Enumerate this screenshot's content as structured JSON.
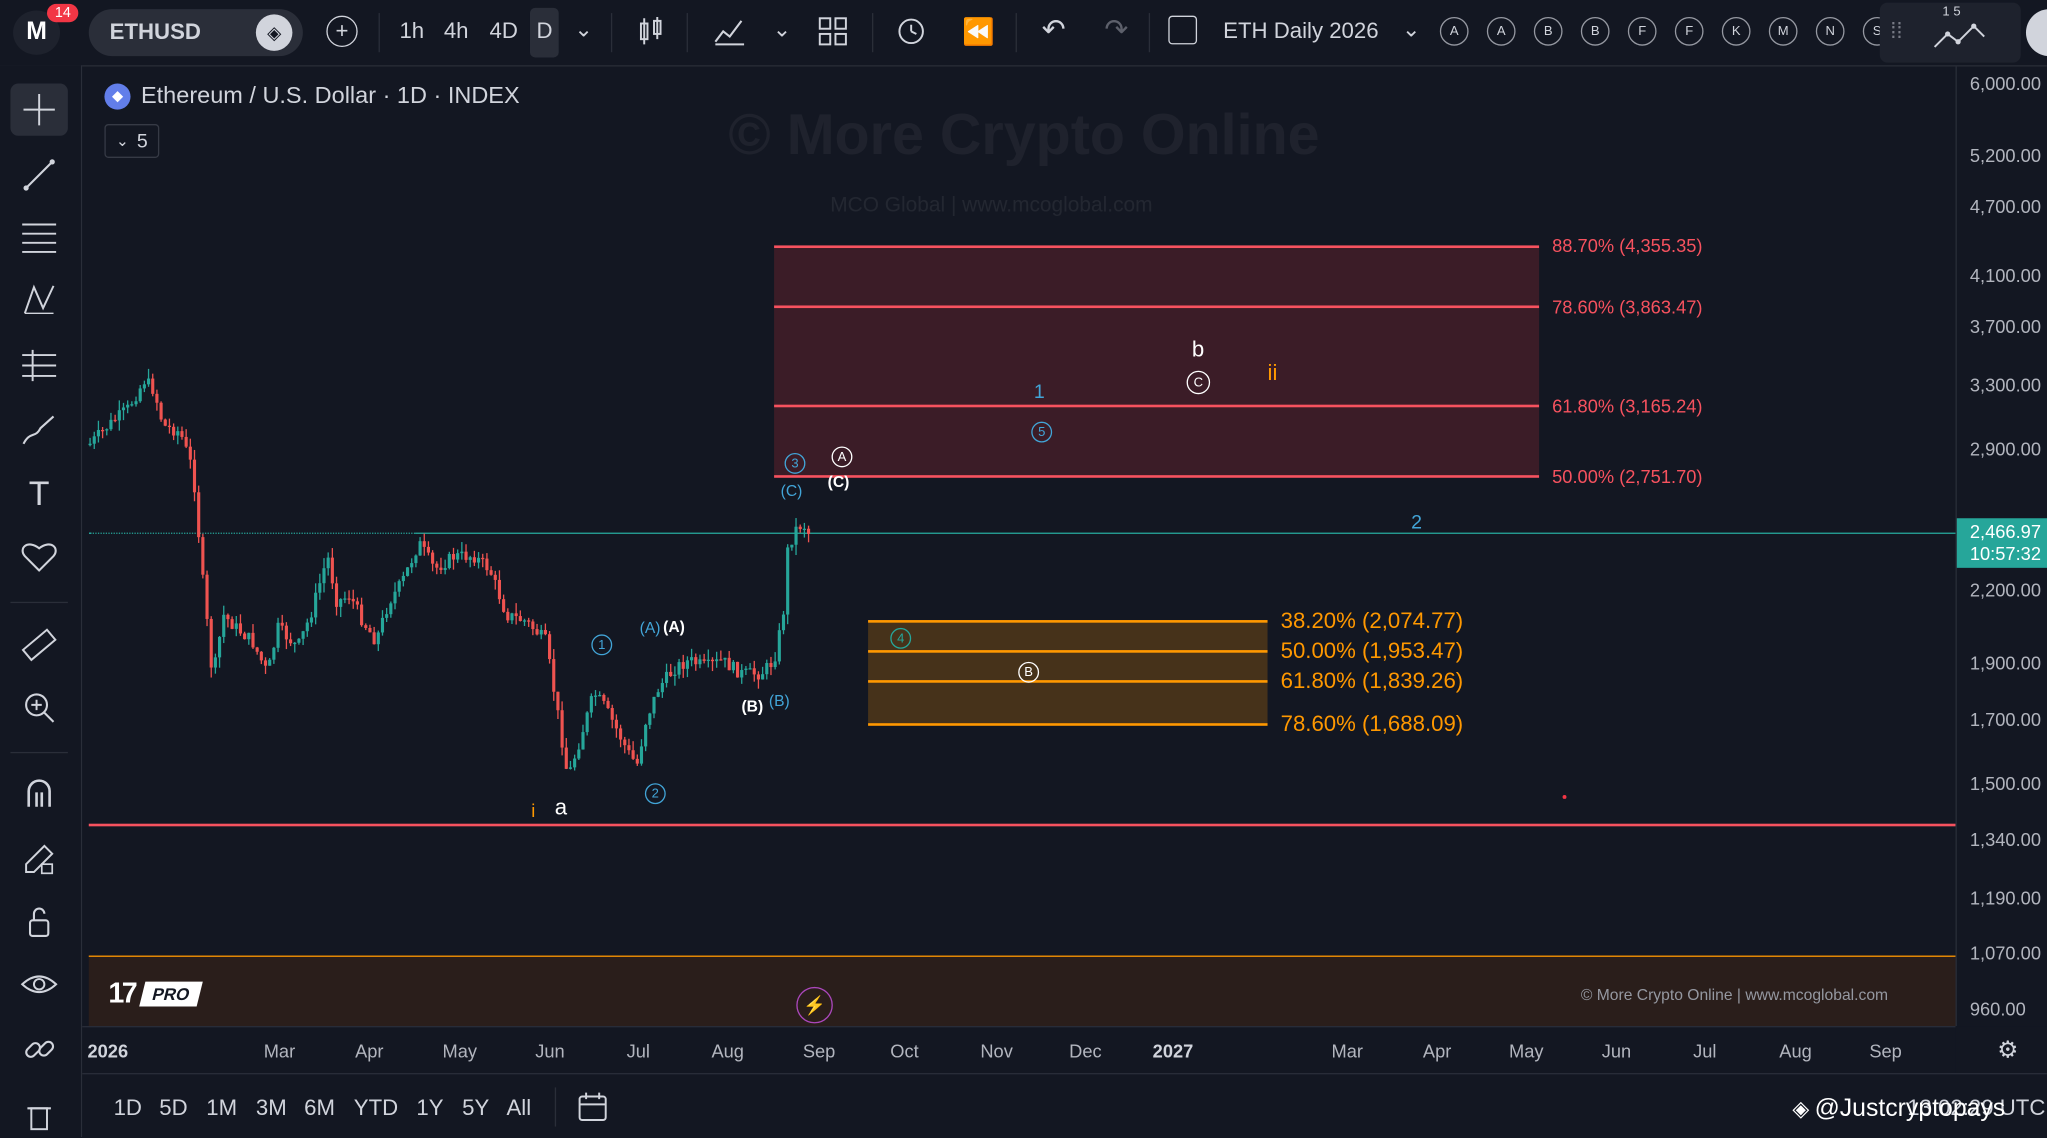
{
  "topbar": {
    "notifications_badge": "14",
    "symbol": "ETHUSD",
    "intervals": [
      "1h",
      "4h",
      "4D",
      "D"
    ],
    "active_interval": "D",
    "layout_name": "ETH Daily 2026",
    "alert_buttons": [
      "A",
      "A",
      "B",
      "B",
      "F",
      "F",
      "K",
      "M",
      "N",
      "S"
    ],
    "partial_text": "1 5"
  },
  "chart": {
    "title": "Ethereum / U.S. Dollar · 1D · INDEX",
    "indicator_count": "5",
    "watermark": "© More Crypto Online",
    "watermark_sub": "MCO Global   |   www.mcoglobal.com",
    "footer_credit": "© More Crypto Online   |   www.mcoglobal.com",
    "brand_logo": "PRO",
    "fib_upper": [
      {
        "label": "88.70% (4,355.35)"
      },
      {
        "label": "78.60% (3,863.47)"
      },
      {
        "label": "61.80% (3,165.24)"
      },
      {
        "label": "50.00% (2,751.70)"
      }
    ],
    "fib_lower": [
      {
        "label": "38.20% (2,074.77)"
      },
      {
        "label": "50.00% (1,953.47)"
      },
      {
        "label": "61.80% (1,839.26)"
      },
      {
        "label": "78.60% (1,688.09)"
      }
    ],
    "waves": {
      "i": "i",
      "a": "a",
      "w1": "1",
      "w2": "2",
      "w3": "3",
      "w4": "4",
      "w5": "5",
      "A": "A",
      "B": "B",
      "C": "C",
      "pA": "(A)",
      "pB": "(B)",
      "pC": "(C)",
      "b": "b",
      "ii": "ii",
      "one": "1",
      "two": "2"
    },
    "colors": {
      "up": "#26a69a",
      "down": "#ef5350",
      "fib_upper": "#f7525f",
      "fib_lower": "#ff9800",
      "current_price": "#26a69a",
      "wave_blue": "#42a5d8",
      "wave_orange": "#ff9800"
    }
  },
  "price_axis": {
    "labels": [
      "6,000.00",
      "5,200.00",
      "4,700.00",
      "4,100.00",
      "3,700.00",
      "3,300.00",
      "2,900.00",
      "2,200.00",
      "1,900.00",
      "1,700.00",
      "1,500.00",
      "1,340.00",
      "1,190.00",
      "1,070.00",
      "960.00"
    ],
    "current_price": "2,466.97",
    "countdown": "10:57:32"
  },
  "time_axis": {
    "labels": [
      "2026",
      "Mar",
      "Apr",
      "May",
      "Jun",
      "Jul",
      "Aug",
      "Sep",
      "Oct",
      "Nov",
      "Dec",
      "2027",
      "Mar",
      "Apr",
      "May",
      "Jun",
      "Jul",
      "Aug",
      "Sep"
    ]
  },
  "bottombar": {
    "ranges": [
      "1D",
      "5D",
      "1M",
      "3M",
      "6M",
      "YTD",
      "1Y",
      "5Y",
      "All"
    ],
    "time": "13:02:29 UTC",
    "watermark": "@Justcryptopays"
  }
}
